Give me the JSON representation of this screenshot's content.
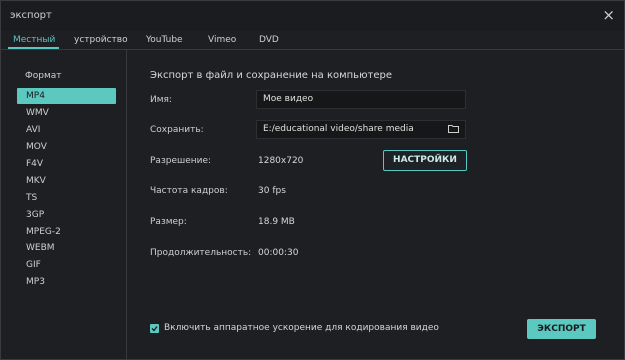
{
  "window": {
    "title": "экспорт",
    "close_symbol": "×"
  },
  "tabs": [
    {
      "label": "Местный",
      "active": true
    },
    {
      "label": "устройство",
      "active": false
    },
    {
      "label": "YouTube",
      "active": false
    },
    {
      "label": "Vimeo",
      "active": false
    },
    {
      "label": "DVD",
      "active": false
    }
  ],
  "sidebar": {
    "header": "Формат",
    "formats": [
      "MP4",
      "WMV",
      "AVI",
      "MOV",
      "F4V",
      "MKV",
      "TS",
      "3GP",
      "MPEG-2",
      "WEBM",
      "GIF",
      "MP3"
    ],
    "selected": "MP4"
  },
  "main": {
    "heading": "Экспорт в файл и сохранение на компьютере",
    "name_label": "Имя:",
    "name_value": "Мое видео",
    "save_label": "Сохранить:",
    "save_value": "E:/educational video/share media",
    "resolution_label": "Разрешение:",
    "resolution_value": "1280x720",
    "settings_button": "НАСТРОЙКИ",
    "framerate_label": "Частота кадров:",
    "framerate_value": "30 fps",
    "size_label": "Размер:",
    "size_value": "18.9 MB",
    "duration_label": "Продолжительность:",
    "duration_value": "00:00:30",
    "hw_accel_label": "Включить аппаратное ускорение для кодирования видео",
    "hw_accel_checked": true,
    "export_button": "ЭКСПОРТ"
  },
  "colors": {
    "accent": "#5cc9c1",
    "background": "#1e1f23"
  },
  "icons": {
    "close": "close-icon",
    "folder": "folder-icon",
    "check": "checkmark-icon"
  }
}
